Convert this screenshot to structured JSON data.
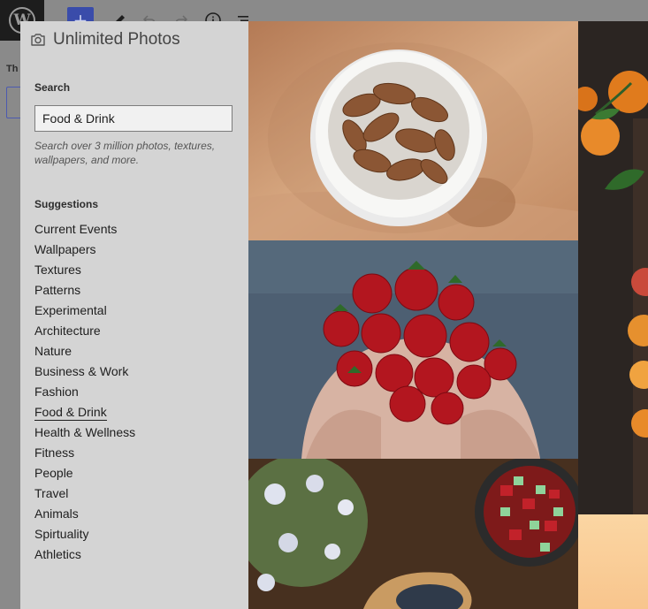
{
  "editor": {
    "toolbar": {
      "add_icon": "plus-icon",
      "edit_icon": "pencil-icon",
      "undo_icon": "undo-icon",
      "redo_icon": "redo-icon",
      "info_icon": "info-icon",
      "outline_icon": "list-view-icon"
    },
    "sidebar_label": "Th"
  },
  "panel": {
    "brand_title": "Unlimited Photos",
    "brand_icon": "camera-icon",
    "search": {
      "label": "Search",
      "value": "Food & Drink",
      "help": "Search over 3 million photos, textures, wallpapers, and more."
    },
    "suggestions": {
      "label": "Suggestions",
      "items": [
        "Current Events",
        "Wallpapers",
        "Textures",
        "Patterns",
        "Experimental",
        "Architecture",
        "Nature",
        "Business & Work",
        "Fashion",
        "Food & Drink",
        "Health & Wellness",
        "Fitness",
        "People",
        "Travel",
        "Animals",
        "Spirtuality",
        "Athletics"
      ],
      "active": "Food & Drink"
    }
  },
  "photos": [
    {
      "subject": "almonds in white ramekin",
      "colors": {
        "bg": "#c9956d",
        "accent": "#8b5634"
      }
    },
    {
      "subject": "hands holding strawberries",
      "colors": {
        "bg": "#4d5f72",
        "accent": "#b3161f"
      }
    },
    {
      "subject": "salad bowls on wooden table",
      "colors": {
        "bg": "#3e2a1c",
        "accent": "#c2222a"
      }
    },
    {
      "subject": "oranges on dark board",
      "colors": {
        "bg": "#2b2522",
        "accent": "#e07b1d"
      }
    },
    {
      "subject": "peach gradient texture",
      "colors": {
        "bg": "#fbd6a3",
        "accent": "#f6be7a"
      }
    }
  ]
}
